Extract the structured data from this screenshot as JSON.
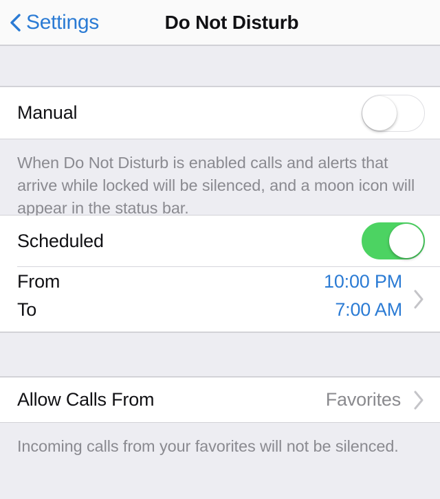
{
  "navbar": {
    "back_label": "Settings",
    "back_icon": "chevron-left-icon",
    "title": "Do Not Disturb"
  },
  "manual_section": {
    "row": {
      "label": "Manual",
      "toggle_state": "off"
    },
    "footnote": "When Do Not Disturb is enabled calls and alerts that arrive while locked will be silenced, and a moon icon will appear in the status bar."
  },
  "schedule_section": {
    "scheduled_row": {
      "label": "Scheduled",
      "toggle_state": "on"
    },
    "from_row": {
      "label": "From",
      "value": "10:00 PM"
    },
    "to_row": {
      "label": "To",
      "value": "7:00 AM"
    },
    "disclosure_icon": "chevron-right-icon"
  },
  "calls_section": {
    "row": {
      "label": "Allow Calls From",
      "value": "Favorites",
      "disclosure_icon": "chevron-right-icon"
    },
    "footnote": "Incoming calls from your favorites will not be silenced."
  },
  "colors": {
    "accent_blue": "#2b7bd4",
    "toggle_on_green": "#4cd362",
    "group_background": "#ffffff",
    "page_background": "#ededf2",
    "secondary_text": "#8a8a8e",
    "chevron_gray": "#c4c4c8"
  }
}
